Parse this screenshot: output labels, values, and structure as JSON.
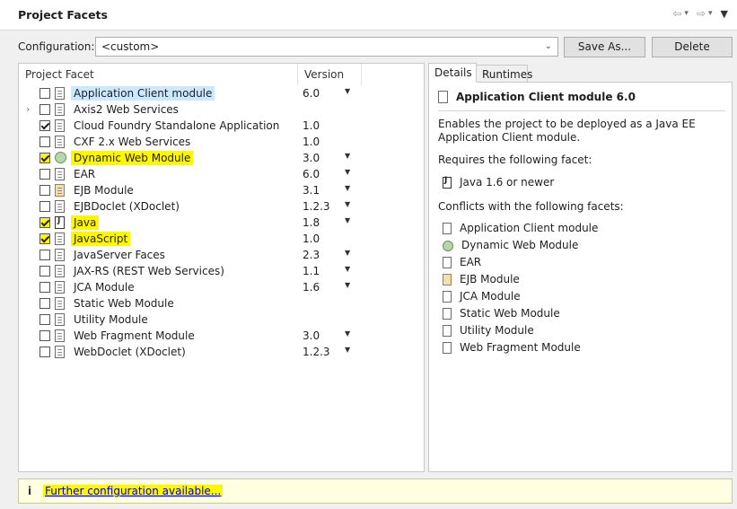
{
  "header": {
    "title": "Project Facets",
    "nav": {
      "back": "⇦",
      "forward": "⇨",
      "dropdown": "▾",
      "menu": "▼"
    }
  },
  "config": {
    "label": "Configuration:",
    "value": "<custom>",
    "save_as": "Save As...",
    "delete": "Delete"
  },
  "facets": {
    "col_facet": "Project Facet",
    "col_version": "Version",
    "rows": [
      {
        "label": "Application Client module",
        "version": "6.0",
        "dropdown": true,
        "checked": false,
        "icon": "doc-icon"
      },
      {
        "label": "Axis2 Web Services",
        "version": "",
        "dropdown": false,
        "checked": false,
        "icon": "doc-icon",
        "expandable": true
      },
      {
        "label": "Cloud Foundry Standalone Application",
        "version": "1.0",
        "dropdown": false,
        "checked": true,
        "icon": "doc-icon"
      },
      {
        "label": "CXF 2.x Web Services",
        "version": "1.0",
        "dropdown": false,
        "checked": false,
        "icon": "doc-icon"
      },
      {
        "label": "Dynamic Web Module",
        "version": "3.0",
        "dropdown": true,
        "checked": true,
        "icon": "globe-icon"
      },
      {
        "label": "EAR",
        "version": "6.0",
        "dropdown": true,
        "checked": false,
        "icon": "doc-icon"
      },
      {
        "label": "EJB Module",
        "version": "3.1",
        "dropdown": true,
        "checked": false,
        "icon": "bean-icon"
      },
      {
        "label": "EJBDoclet (XDoclet)",
        "version": "1.2.3",
        "dropdown": true,
        "checked": false,
        "icon": "doc-icon"
      },
      {
        "label": "Java",
        "version": "1.8",
        "dropdown": true,
        "checked": true,
        "icon": "java-icon"
      },
      {
        "label": "JavaScript",
        "version": "1.0",
        "dropdown": false,
        "checked": true,
        "icon": "doc-icon"
      },
      {
        "label": "JavaServer Faces",
        "version": "2.3",
        "dropdown": true,
        "checked": false,
        "icon": "doc-icon"
      },
      {
        "label": "JAX-RS (REST Web Services)",
        "version": "1.1",
        "dropdown": true,
        "checked": false,
        "icon": "doc-icon"
      },
      {
        "label": "JCA Module",
        "version": "1.6",
        "dropdown": true,
        "checked": false,
        "icon": "doc-icon"
      },
      {
        "label": "Static Web Module",
        "version": "",
        "dropdown": false,
        "checked": false,
        "icon": "doc-icon"
      },
      {
        "label": "Utility Module",
        "version": "",
        "dropdown": false,
        "checked": false,
        "icon": "doc-icon"
      },
      {
        "label": "Web Fragment Module",
        "version": "3.0",
        "dropdown": true,
        "checked": false,
        "icon": "doc-icon"
      },
      {
        "label": "WebDoclet (XDoclet)",
        "version": "1.2.3",
        "dropdown": true,
        "checked": false,
        "icon": "doc-icon"
      }
    ]
  },
  "details": {
    "tab_details": "Details",
    "tab_runtimes": "Runtimes",
    "title": "Application Client module 6.0",
    "description": "Enables the project to be deployed as a Java EE Application Client module.",
    "requires_label": "Requires the following facet:",
    "requires_item": "Java 1.6 or newer",
    "conflicts_label": "Conflicts with the following facets:",
    "conflicts": [
      {
        "label": "Application Client module",
        "icon": "doc-icon"
      },
      {
        "label": "Dynamic Web Module",
        "icon": "globe-icon"
      },
      {
        "label": "EAR",
        "icon": "doc-icon"
      },
      {
        "label": "EJB Module",
        "icon": "bean-icon"
      },
      {
        "label": "JCA Module",
        "icon": "doc-icon"
      },
      {
        "label": "Static Web Module",
        "icon": "doc-icon"
      },
      {
        "label": "Utility Module",
        "icon": "doc-icon"
      },
      {
        "label": "Web Fragment Module",
        "icon": "doc-icon"
      }
    ]
  },
  "footer": {
    "info_icon": "i",
    "link": "Further configuration available..."
  },
  "colors": {
    "highlight": "#fff700",
    "selection": "#cce8ff",
    "link": "#0000cc",
    "footer_bg": "#ffffe1"
  }
}
